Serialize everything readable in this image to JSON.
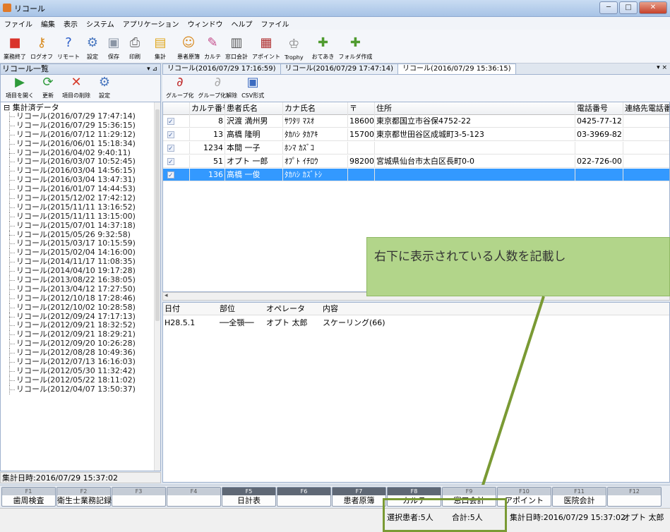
{
  "window": {
    "title": "リコール"
  },
  "menu": [
    "ファイル",
    "編集",
    "表示",
    "システム",
    "アプリケーション",
    "ウィンドウ",
    "ヘルプ",
    "ファイル"
  ],
  "toolbar": [
    {
      "label": "業務終了",
      "icon": "exit-icon"
    },
    {
      "label": "ログオフ",
      "icon": "logoff-icon"
    },
    {
      "label": "リモート",
      "icon": "help-icon"
    },
    {
      "label": "設定",
      "icon": "gear-icon"
    },
    {
      "label": "保存",
      "icon": "save-icon"
    },
    {
      "label": "印刷",
      "icon": "print-icon"
    },
    {
      "label": "集計",
      "icon": "aggregate-icon"
    },
    {
      "label": "患者原簿",
      "icon": "patient-icon"
    },
    {
      "label": "カルテ",
      "icon": "chart-icon"
    },
    {
      "label": "窓口会計",
      "icon": "register-icon"
    },
    {
      "label": "アポイント",
      "icon": "calendar-icon"
    },
    {
      "label": "Trophy",
      "icon": "trophy-icon"
    },
    {
      "label": "おてあき",
      "icon": "tool-icon"
    },
    {
      "label": "フォルダ作成",
      "icon": "folder-icon"
    }
  ],
  "left_panel": {
    "header": "リコール一覧",
    "pin": "▾ ⊿",
    "buttons": [
      {
        "label": "項目を開く",
        "icon": "open-icon"
      },
      {
        "label": "更新",
        "icon": "refresh-icon"
      },
      {
        "label": "項目の削除",
        "icon": "delete-icon"
      },
      {
        "label": "設定",
        "icon": "gear-icon"
      }
    ],
    "tree_root": "集計済データ",
    "items": [
      "リコール(2016/07/29 17:47:14)",
      "リコール(2016/07/29 15:36:15)",
      "リコール(2016/07/12 11:29:12)",
      "リコール(2016/06/01 15:18:34)",
      "リコール(2016/04/02 9:40:11)",
      "リコール(2016/03/07 10:52:45)",
      "リコール(2016/03/04 14:56:15)",
      "リコール(2016/03/04 13:47:31)",
      "リコール(2016/01/07 14:44:53)",
      "リコール(2015/12/02 17:42:12)",
      "リコール(2015/11/11 13:16:52)",
      "リコール(2015/11/11 13:15:00)",
      "リコール(2015/07/01 14:37:18)",
      "リコール(2015/05/26 9:32:58)",
      "リコール(2015/03/17 10:15:59)",
      "リコール(2015/02/04 14:16:00)",
      "リコール(2014/11/17 11:08:35)",
      "リコール(2014/04/10 19:17:28)",
      "リコール(2013/08/22 16:38:05)",
      "リコール(2013/04/12 17:27:50)",
      "リコール(2012/10/18 17:28:46)",
      "リコール(2012/10/02 10:28:58)",
      "リコール(2012/09/24 17:17:13)",
      "リコール(2012/09/21 18:32:52)",
      "リコール(2012/09/21 18:29:21)",
      "リコール(2012/09/20 10:26:28)",
      "リコール(2012/08/28 10:49:36)",
      "リコール(2012/07/13 16:16:03)",
      "リコール(2012/05/30 11:32:42)",
      "リコール(2012/05/22 18:11:02)",
      "リコール(2012/04/07 13:50:37)"
    ],
    "footer": "集計日時:2016/07/29 15:37:02"
  },
  "tabs": [
    "リコール(2016/07/29 17:16:59)",
    "リコール(2016/07/29 17:47:14)",
    "リコール(2016/07/29 15:36:15)"
  ],
  "tabs_more": "▾ ×",
  "right_toolbar": [
    {
      "label": "グループ化",
      "icon": "group-icon"
    },
    {
      "label": "グループ化解除",
      "icon": "ungroup-icon"
    },
    {
      "label": "CSV形式",
      "icon": "csv-icon"
    }
  ],
  "grid": {
    "columns": [
      "",
      "カルテ番号",
      "患者氏名",
      "カナ氏名",
      "〒",
      "住所",
      "電話番号",
      "連絡先電話番号"
    ],
    "rows": [
      [
        "",
        "8",
        "沢渡 満州男",
        "ｻﾜﾀﾘ ﾏｽｵ",
        "18600",
        "東京都国立市谷保4752-22",
        "0425-77-12",
        ""
      ],
      [
        "",
        "13",
        "高橋 隆明",
        "ﾀｶﾊｼ ﾀｶｱｷ",
        "15700",
        "東京都世田谷区成城町3-5-123",
        "03-3969-82",
        ""
      ],
      [
        "",
        "1234",
        "本間 一子",
        "ﾎﾝﾏ ｶｽﾞｺ",
        "",
        "",
        "",
        ""
      ],
      [
        "",
        "51",
        "オプト 一郎",
        "ｵﾌﾟﾄ ｲﾁﾛｳ",
        "98200",
        "宮城県仙台市太白区長町0-0",
        "022-726-00",
        ""
      ],
      [
        "",
        "136",
        "高橋 一俊",
        "ﾀｶﾊｼ ｶｽﾞﾄｼ",
        "",
        "",
        "",
        ""
      ]
    ],
    "selected_index": 4
  },
  "detail": {
    "columns": [
      "日付",
      "部位",
      "オペレータ",
      "内容"
    ],
    "rows": [
      [
        "H28.5.1",
        "──全顎──",
        "オプト 太郎",
        "スケーリング(66)"
      ]
    ]
  },
  "callout": {
    "text": "右下に表示されている人数を記載し"
  },
  "fkeys": [
    {
      "num": "F1",
      "label": "歯周検査",
      "shade": "light"
    },
    {
      "num": "F2",
      "label": "衛生士業務記録",
      "shade": "light"
    },
    {
      "num": "F3",
      "label": "",
      "shade": "light"
    },
    {
      "num": "F4",
      "label": "",
      "shade": "light"
    },
    {
      "num": "F5",
      "label": "日計表",
      "shade": "dark"
    },
    {
      "num": "F6",
      "label": "",
      "shade": "dark"
    },
    {
      "num": "F7",
      "label": "患者原簿",
      "shade": "dark"
    },
    {
      "num": "F8",
      "label": "カルテ",
      "shade": "dark"
    },
    {
      "num": "F9",
      "label": "窓口会計",
      "shade": "light"
    },
    {
      "num": "F10",
      "label": "アポイント",
      "shade": "light"
    },
    {
      "num": "F11",
      "label": "医院会計",
      "shade": "light"
    },
    {
      "num": "F12",
      "label": "",
      "shade": "light"
    }
  ],
  "status": {
    "selected": "選択患者:5人",
    "total": "合計:5人",
    "aggregate_time": "集計日時:2016/07/29 15:37:02",
    "operator": "オプト 太郎"
  },
  "colors": {
    "selection": "#3399ff",
    "callout": "#b2d58a",
    "annotation": "#7a9a34"
  }
}
